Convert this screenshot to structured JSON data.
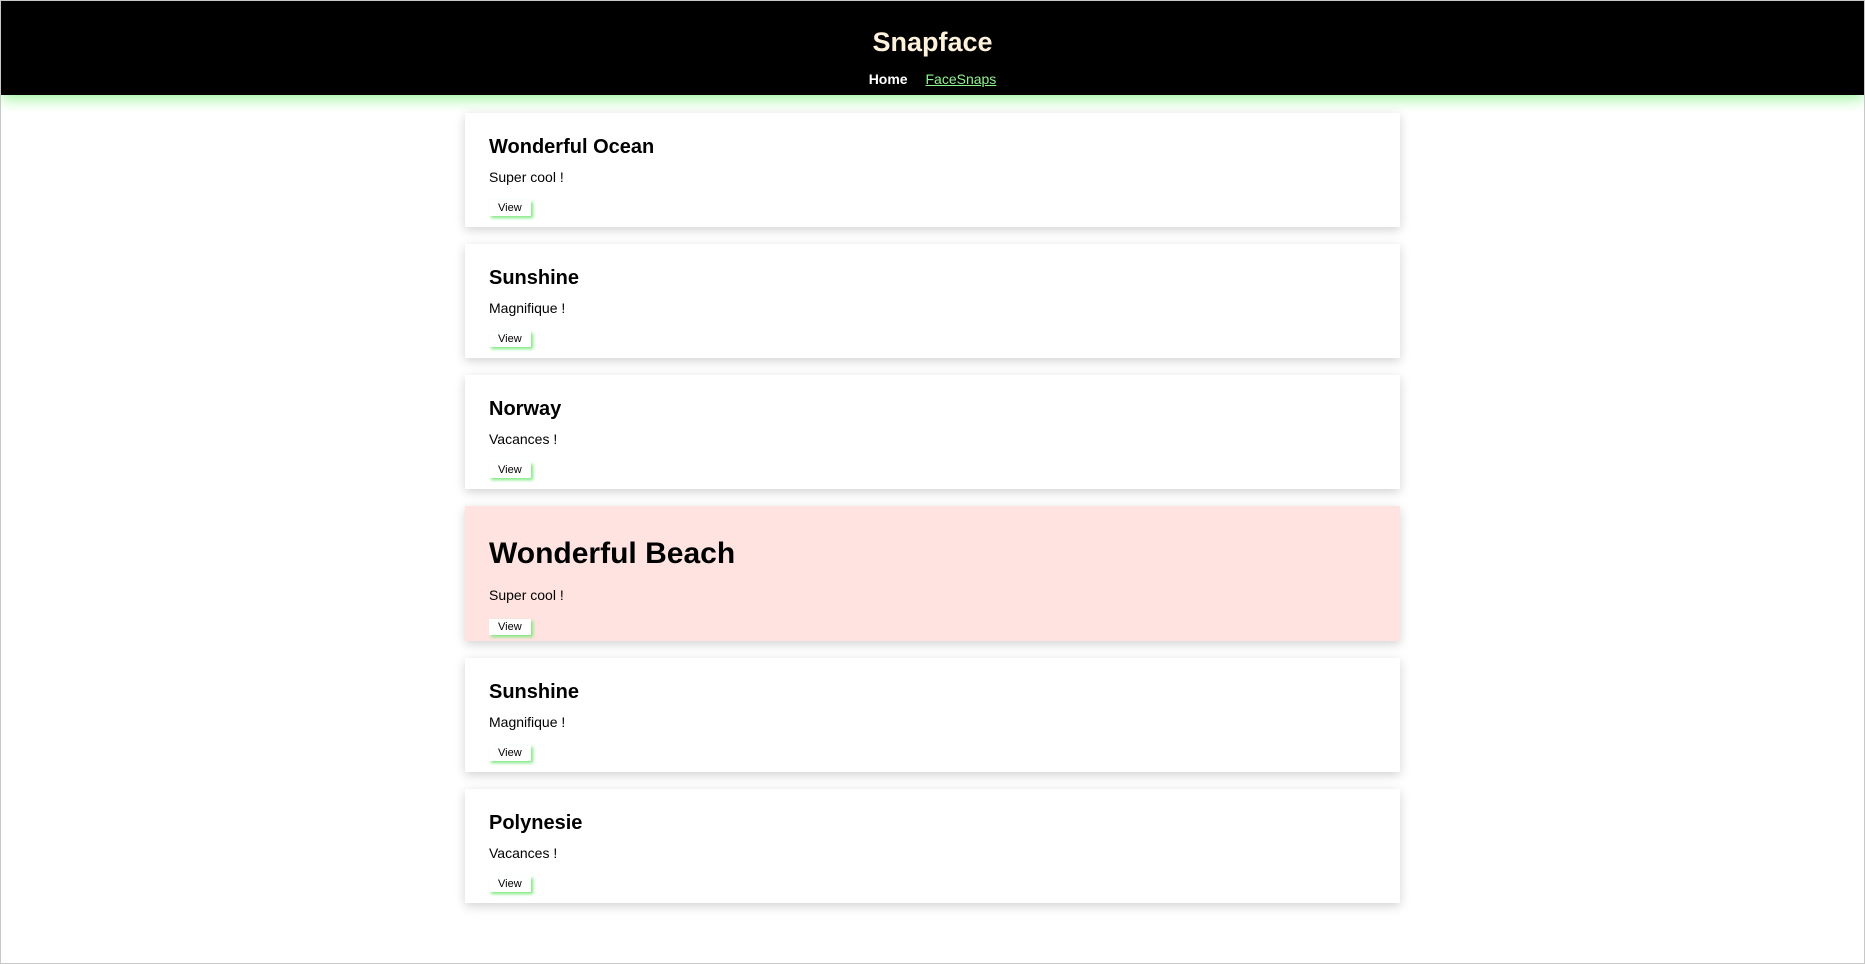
{
  "header": {
    "title": "Snapface",
    "nav": {
      "home": "Home",
      "facesnaps": "FaceSnaps"
    }
  },
  "cards": [
    {
      "title": "Wonderful Ocean",
      "description": "Super cool !",
      "button": "View"
    },
    {
      "title": "Sunshine",
      "description": "Magnifique !",
      "button": "View"
    },
    {
      "title": "Norway",
      "description": "Vacances !",
      "button": "View"
    },
    {
      "title": "Wonderful Beach",
      "description": "Super cool !",
      "button": "View"
    },
    {
      "title": "Sunshine",
      "description": "Magnifique !",
      "button": "View"
    },
    {
      "title": "Polynesie",
      "description": "Vacances !",
      "button": "View"
    }
  ],
  "colors": {
    "header_bg": "#000000",
    "title_color": "#fff2dc",
    "accent_green": "#8ef58e",
    "highlight_card_bg": "#ffe3e0"
  }
}
